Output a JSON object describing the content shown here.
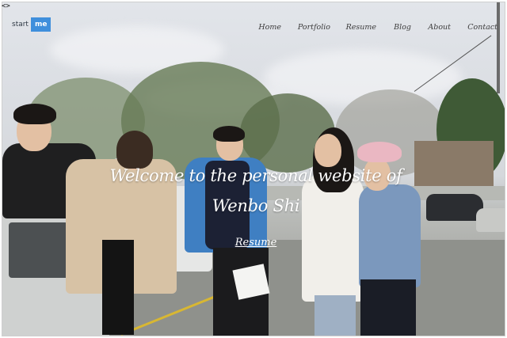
{
  "corner": "<>",
  "brand": {
    "part1": "start",
    "part2": "me"
  },
  "nav": {
    "items": [
      {
        "label": "Home"
      },
      {
        "label": "Portfolio"
      },
      {
        "label": "Resume"
      },
      {
        "label": "Blog"
      },
      {
        "label": "About"
      },
      {
        "label": "Contact"
      }
    ]
  },
  "hero": {
    "headline_line1": "Welcome to the personal website of",
    "headline_line2": "Wenbo Shi",
    "cta_label": "Resume"
  }
}
